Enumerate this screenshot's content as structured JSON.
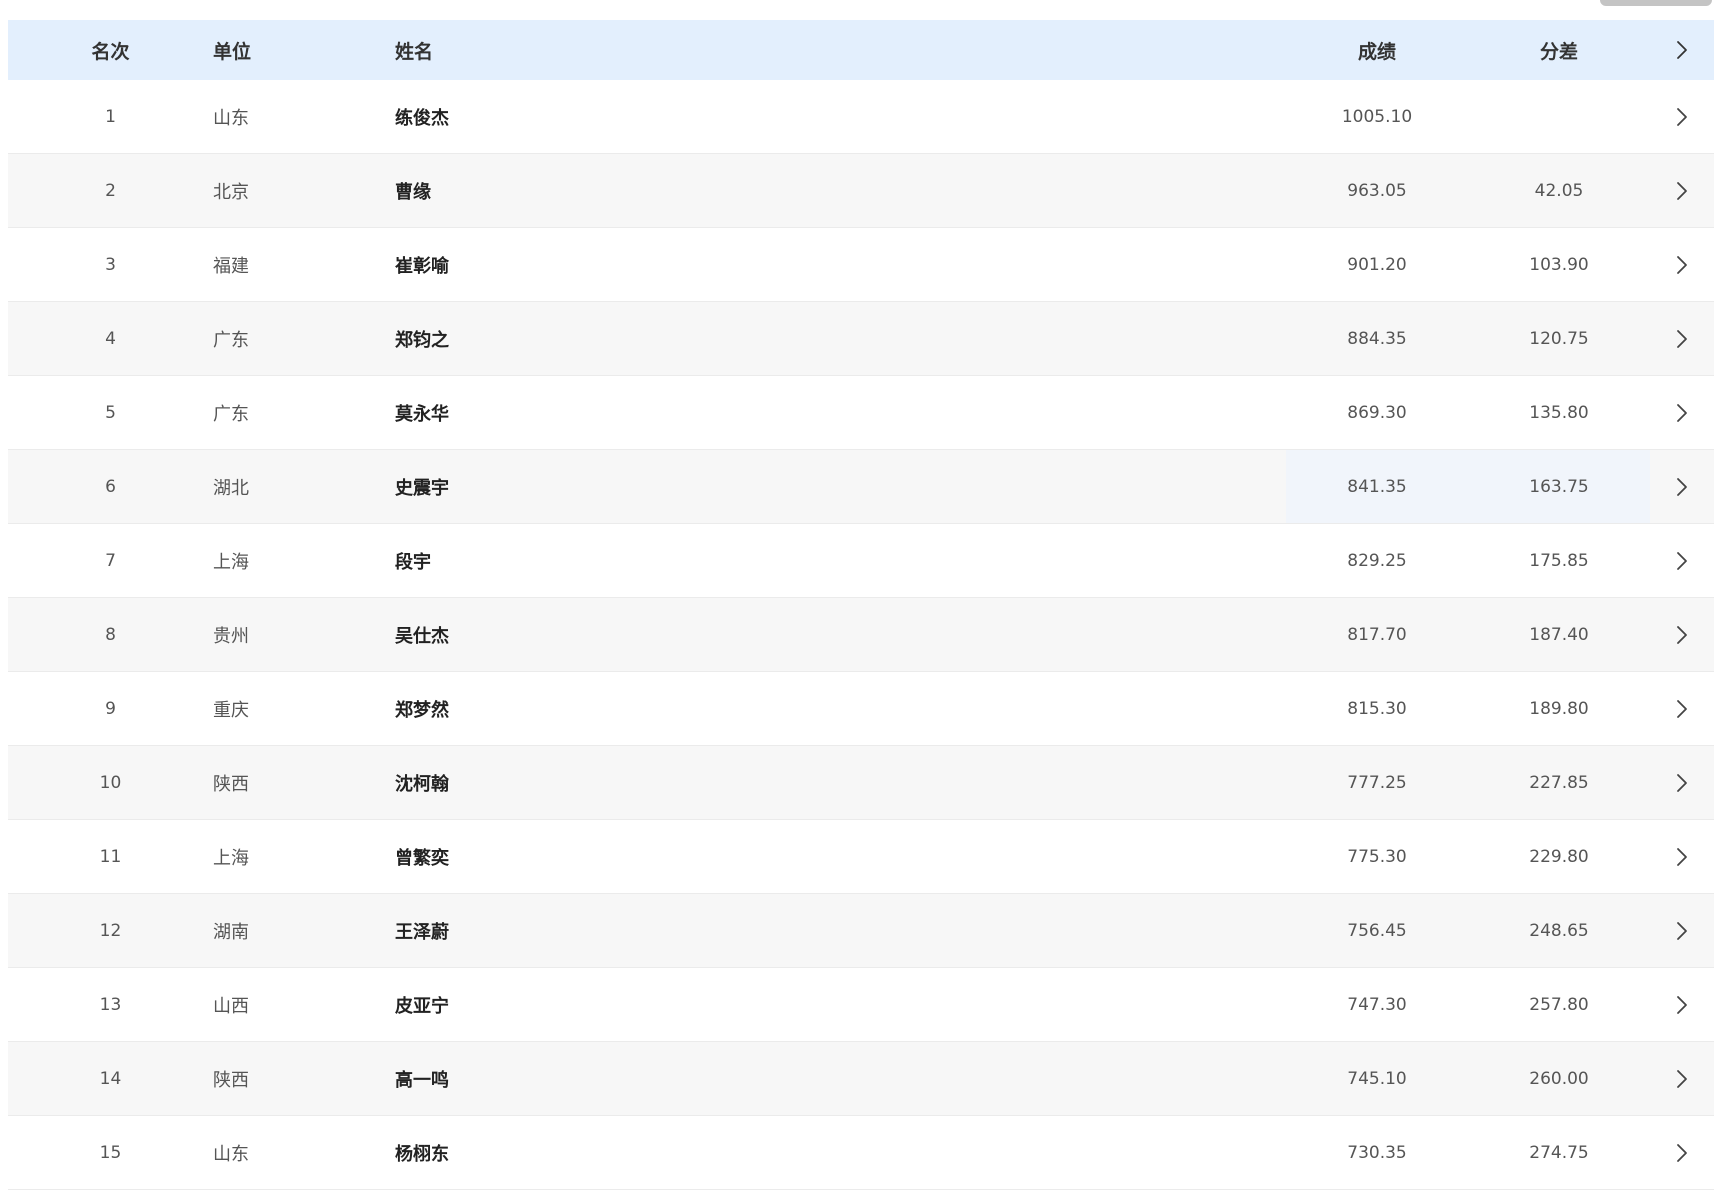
{
  "table": {
    "headers": {
      "rank": "名次",
      "unit": "单位",
      "name": "姓名",
      "score": "成绩",
      "diff": "分差"
    },
    "rows": [
      {
        "rank": "1",
        "unit": "山东",
        "name": "练俊杰",
        "score": "1005.10",
        "diff": ""
      },
      {
        "rank": "2",
        "unit": "北京",
        "name": "曹缘",
        "score": "963.05",
        "diff": "42.05"
      },
      {
        "rank": "3",
        "unit": "福建",
        "name": "崔彰喻",
        "score": "901.20",
        "diff": "103.90"
      },
      {
        "rank": "4",
        "unit": "广东",
        "name": "郑钧之",
        "score": "884.35",
        "diff": "120.75"
      },
      {
        "rank": "5",
        "unit": "广东",
        "name": "莫永华",
        "score": "869.30",
        "diff": "135.80"
      },
      {
        "rank": "6",
        "unit": "湖北",
        "name": "史震宇",
        "score": "841.35",
        "diff": "163.75"
      },
      {
        "rank": "7",
        "unit": "上海",
        "name": "段宇",
        "score": "829.25",
        "diff": "175.85"
      },
      {
        "rank": "8",
        "unit": "贵州",
        "name": "吴仕杰",
        "score": "817.70",
        "diff": "187.40"
      },
      {
        "rank": "9",
        "unit": "重庆",
        "name": "郑梦然",
        "score": "815.30",
        "diff": "189.80"
      },
      {
        "rank": "10",
        "unit": "陕西",
        "name": "沈柯翰",
        "score": "777.25",
        "diff": "227.85"
      },
      {
        "rank": "11",
        "unit": "上海",
        "name": "曾繁奕",
        "score": "775.30",
        "diff": "229.80"
      },
      {
        "rank": "12",
        "unit": "湖南",
        "name": "王泽蔚",
        "score": "756.45",
        "diff": "248.65"
      },
      {
        "rank": "13",
        "unit": "山西",
        "name": "皮亚宁",
        "score": "747.30",
        "diff": "257.80"
      },
      {
        "rank": "14",
        "unit": "陕西",
        "name": "高一鸣",
        "score": "745.10",
        "diff": "260.00"
      },
      {
        "rank": "15",
        "unit": "山东",
        "name": "杨栩东",
        "score": "730.35",
        "diff": "274.75"
      }
    ]
  },
  "icons": {
    "row_expand": "chevron-right-icon"
  },
  "colors": {
    "header_bg": "#e3effd",
    "alt_row_bg": "#f7f7f7",
    "hover_cell_bg": "#f1f5fb"
  }
}
